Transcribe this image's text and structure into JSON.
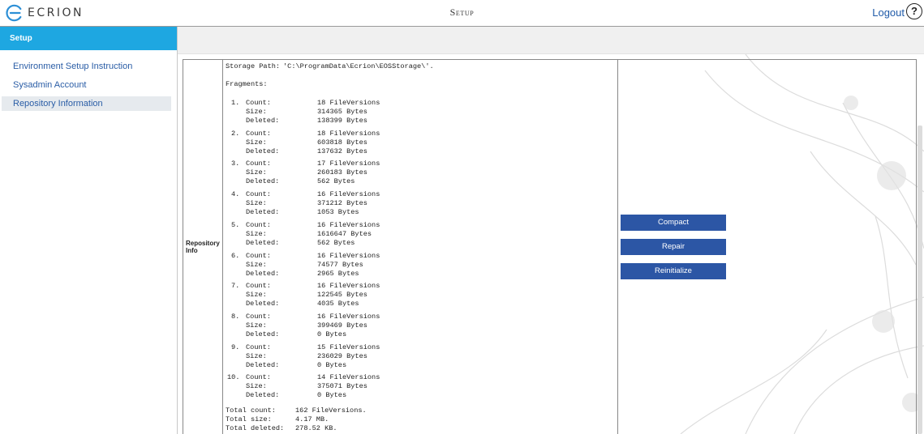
{
  "header": {
    "brand": "ECRION",
    "title": "Setup",
    "logout_label": "Logout",
    "help_label": "?"
  },
  "sidebar": {
    "header": "Setup",
    "items": [
      {
        "label": "Environment Setup Instruction",
        "active": false
      },
      {
        "label": "Sysadmin Account",
        "active": false
      },
      {
        "label": "Repository Information",
        "active": true
      }
    ]
  },
  "repository": {
    "section_label": "Repository Info",
    "storage_path_label": "Storage Path:",
    "storage_path": "'C:\\ProgramData\\Ecrion\\EOSStorage\\'.",
    "fragments_label": "Fragments:",
    "field_labels": {
      "count": "Count:",
      "size": "Size:",
      "deleted": "Deleted:"
    },
    "fragments": [
      {
        "index": "1.",
        "count": "18 FileVersions",
        "size": "314365 Bytes",
        "deleted": "138399 Bytes"
      },
      {
        "index": "2.",
        "count": "18 FileVersions",
        "size": "603818 Bytes",
        "deleted": "137632 Bytes"
      },
      {
        "index": "3.",
        "count": "17 FileVersions",
        "size": "260183 Bytes",
        "deleted": "562 Bytes"
      },
      {
        "index": "4.",
        "count": "16 FileVersions",
        "size": "371212 Bytes",
        "deleted": "1053 Bytes"
      },
      {
        "index": "5.",
        "count": "16 FileVersions",
        "size": "1616647 Bytes",
        "deleted": "562 Bytes"
      },
      {
        "index": "6.",
        "count": "16 FileVersions",
        "size": "74577 Bytes",
        "deleted": "2965 Bytes"
      },
      {
        "index": "7.",
        "count": "16 FileVersions",
        "size": "122545 Bytes",
        "deleted": "4035 Bytes"
      },
      {
        "index": "8.",
        "count": "16 FileVersions",
        "size": "399469 Bytes",
        "deleted": "0 Bytes"
      },
      {
        "index": "9.",
        "count": "15 FileVersions",
        "size": "236029 Bytes",
        "deleted": "0 Bytes"
      },
      {
        "index": "10.",
        "count": "14 FileVersions",
        "size": "375071 Bytes",
        "deleted": "0 Bytes"
      }
    ],
    "totals": [
      {
        "label": "Total count:",
        "value": "162 FileVersions."
      },
      {
        "label": "Total size:",
        "value": "4.17 MB."
      },
      {
        "label": "Total deleted:",
        "value": "278.52 KB."
      }
    ]
  },
  "actions": {
    "compact_label": "Compact",
    "repair_label": "Repair",
    "reinitialize_label": "Reinitialize"
  },
  "colors": {
    "accent": "#1ea7e1",
    "button": "#2c56a5",
    "link": "#1f5aa8"
  }
}
